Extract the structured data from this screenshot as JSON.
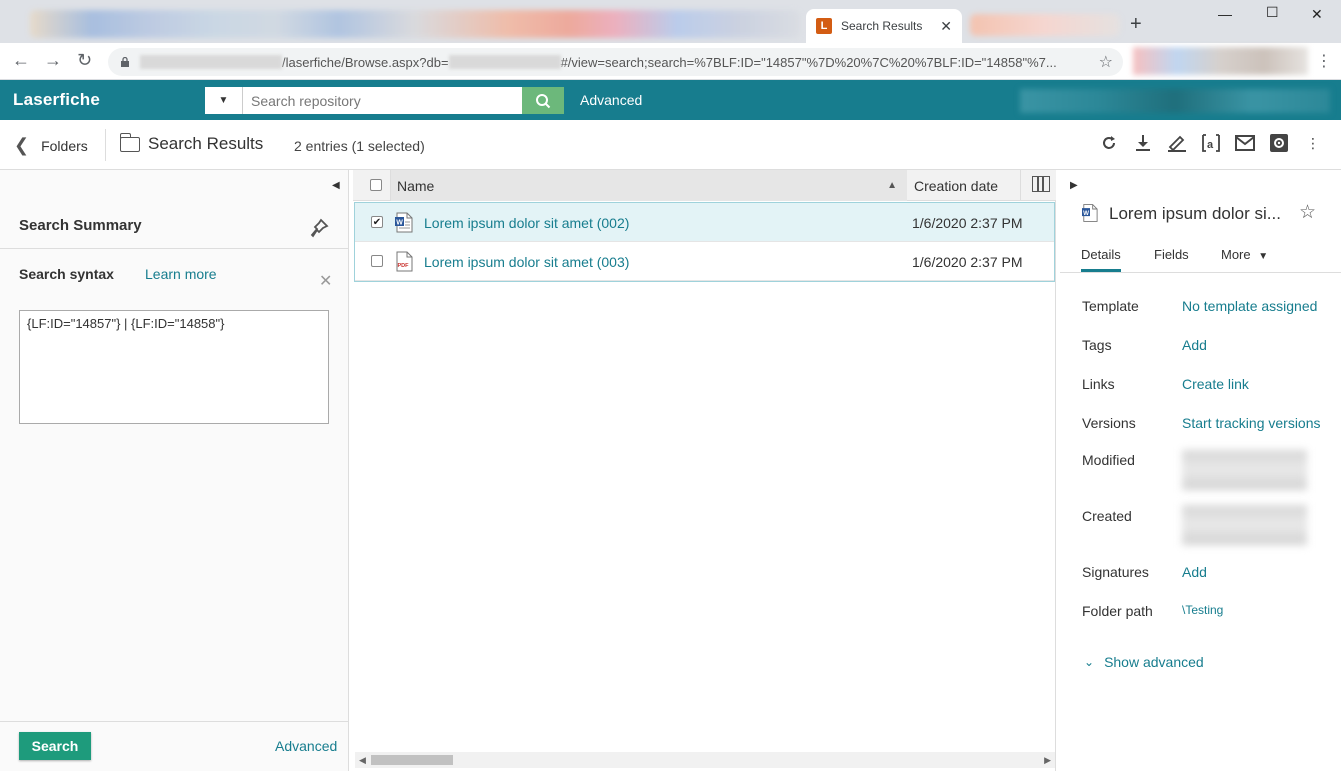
{
  "browser": {
    "active_tab_title": "Search Results",
    "tab_favicon_letter": "L",
    "url_path": "/laserfiche/Browse.aspx?db=",
    "url_hash": "#/view=search;search=%7BLF:ID=\"14857\"%7D%20%7C%20%7BLF:ID=\"14858\"%7..."
  },
  "header": {
    "logo": "Laserfiche",
    "search_placeholder": "Search repository",
    "advanced_label": "Advanced",
    "accent_color": "#177d8e"
  },
  "toolbar": {
    "back_label": "Folders",
    "title": "Search Results",
    "entry_count": "2 entries (1 selected)",
    "icons": [
      "refresh-icon",
      "download-icon",
      "sign-icon",
      "ocr-icon",
      "email-icon",
      "settings-icon",
      "more-icon"
    ]
  },
  "search_panel": {
    "title": "Search Summary",
    "syntax_label": "Search syntax",
    "learn_more": "Learn more",
    "syntax_value": "{LF:ID=\"14857\"} | {LF:ID=\"14858\"}",
    "search_button": "Search",
    "advanced_label": "Advanced"
  },
  "list": {
    "columns": [
      "Name",
      "Creation date"
    ],
    "rows": [
      {
        "name": "Lorem ipsum dolor sit amet (002)",
        "date": "1/6/2020 2:37 PM",
        "type": "word",
        "selected": true
      },
      {
        "name": "Lorem ipsum dolor sit amet (003)",
        "date": "1/6/2020 2:37 PM",
        "type": "pdf",
        "selected": false
      }
    ]
  },
  "details": {
    "title": "Lorem ipsum dolor si...",
    "tabs": [
      "Details",
      "Fields",
      "More"
    ],
    "props": [
      {
        "label": "Template",
        "value": "No template assigned"
      },
      {
        "label": "Tags",
        "value": "Add"
      },
      {
        "label": "Links",
        "value": "Create link"
      },
      {
        "label": "Versions",
        "value": "Start tracking versions"
      },
      {
        "label": "Modified",
        "value": ""
      },
      {
        "label": "Created",
        "value": ""
      },
      {
        "label": "Signatures",
        "value": "Add"
      },
      {
        "label": "Folder path",
        "value": "\\Testing"
      }
    ],
    "show_advanced": "Show advanced"
  }
}
